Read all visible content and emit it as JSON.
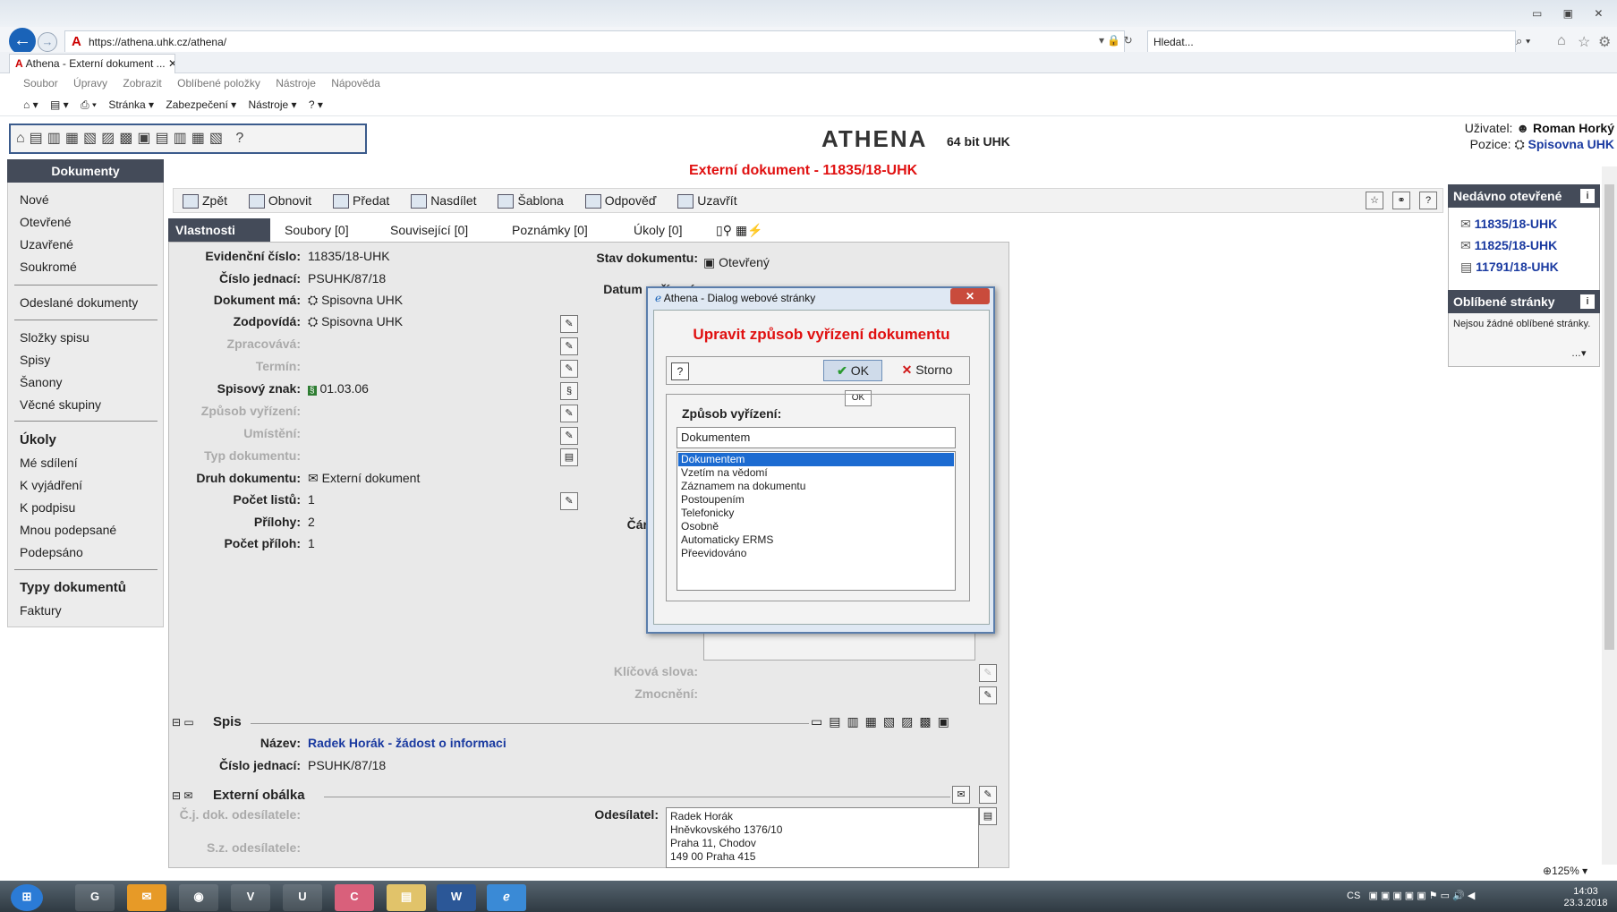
{
  "browser": {
    "url": "https://athena.uhk.cz/athena/",
    "search_placeholder": "Hledat...",
    "tab_title": "Athena - Externí dokument ...",
    "menu": [
      "Soubor",
      "Úpravy",
      "Zobrazit",
      "Oblíbené položky",
      "Nástroje",
      "Nápověda"
    ],
    "commands": [
      "Stránka ▾",
      "Zabezpečení ▾",
      "Nástroje ▾"
    ]
  },
  "app": {
    "brand": "ATHENA",
    "brand_sub": "64 bit UHK",
    "user_label": "Uživatel:",
    "user_name": "Roman Horký",
    "position_label": "Pozice:",
    "position_value": "Spisovna UHK",
    "help": "?"
  },
  "sidebar": {
    "title": "Dokumenty",
    "group1": [
      "Nové",
      "Otevřené",
      "Uzavřené",
      "Soukromé"
    ],
    "group2": [
      "Odeslané dokumenty"
    ],
    "group3": [
      "Složky spisu",
      "Spisy",
      "Šanony",
      "Věcné skupiny"
    ],
    "group4_head": "Úkoly",
    "group4": [
      "Mé sdílení",
      "K vyjádření",
      "K podpisu",
      "Mnou podepsané",
      "Podepsáno"
    ],
    "group5_head": "Typy dokumentů",
    "group5": [
      "Faktury"
    ]
  },
  "main": {
    "title": "Externí dokument - 11835/18-UHK",
    "actions": [
      "Zpět",
      "Obnovit",
      "Předat",
      "Nasdílet",
      "Šablona",
      "Odpověď",
      "Uzavřít"
    ],
    "tabs": [
      "Vlastnosti",
      "Soubory [0]",
      "Související [0]",
      "Poznámky [0]",
      "Úkoly [0]"
    ],
    "fields": [
      {
        "label": "Evidenční číslo:",
        "value": "11835/18-UHK"
      },
      {
        "label": "Číslo jednací:",
        "value": "PSUHK/87/18"
      },
      {
        "label": "Dokument má:",
        "value": "Spisovna UHK"
      },
      {
        "label": "Zodpovídá:",
        "value": "Spisovna UHK"
      },
      {
        "label": "Zpracovává:",
        "value": ""
      },
      {
        "label": "Termín:",
        "value": ""
      },
      {
        "label": "Spisový znak:",
        "value": "01.03.06"
      },
      {
        "label": "Způsob vyřízení:",
        "value": ""
      },
      {
        "label": "Umístění:",
        "value": ""
      },
      {
        "label": "Typ dokumentu:",
        "value": ""
      },
      {
        "label": "Druh dokumentu:",
        "value": "Externí dokument"
      },
      {
        "label": "Počet listů:",
        "value": "1"
      },
      {
        "label": "Přílohy:",
        "value": "2"
      },
      {
        "label": "Počet příloh:",
        "value": "1"
      }
    ],
    "stav_label": "Stav dokumentu:",
    "stav_value": "Otevřený",
    "datum_label": "Datum pořízení:",
    "car_label": "Čár",
    "klicova_slova": "Klíčová slova:",
    "zmocneni": "Zmocnění:",
    "spis": {
      "title": "Spis",
      "nazev_label": "Název:",
      "nazev_value": "Radek Horák - žádost o informaci",
      "cj_label": "Číslo jednací:",
      "cj_value": "PSUHK/87/18"
    },
    "obalka": {
      "title": "Externí obálka",
      "cj_label": "Č.j. dok. odesílatele:",
      "sz_label": "S.z. odesílatele:",
      "odesilatel_label": "Odesílatel:",
      "odesilatel_lines": [
        "Radek Horák",
        "Hněvkovského 1376/10",
        "Praha 11, Chodov",
        "149 00 Praha 415"
      ]
    }
  },
  "right_panel": {
    "recent_title": "Nedávno otevřené",
    "recent": [
      "11835/18-UHK",
      "11825/18-UHK",
      "11791/18-UHK"
    ],
    "fav_title": "Oblíbené stránky",
    "fav_text": "Nejsou žádné oblíbené stránky.",
    "info_icon": "i"
  },
  "dialog": {
    "window_title": "Athena - Dialog webové stránky",
    "heading": "Upravit způsob vyřízení dokumentu",
    "ok_label": "OK",
    "storno_label": "Storno",
    "tooltip": "OK",
    "field_label": "Způsob vyřízení:",
    "input_value": "Dokumentem",
    "options": [
      "Dokumentem",
      "Vzetím na vědomí",
      "Záznamem na dokumentu",
      "Postoupením",
      "Telefonicky",
      "Osobně",
      "Automaticky ERMS",
      "Přeevidováno"
    ],
    "selected_index": 0
  },
  "status": {
    "zoom": "125%",
    "lang": "CS",
    "time": "14:03",
    "date": "23.3.2018"
  },
  "taskbar": [
    "V",
    "U",
    "C"
  ]
}
